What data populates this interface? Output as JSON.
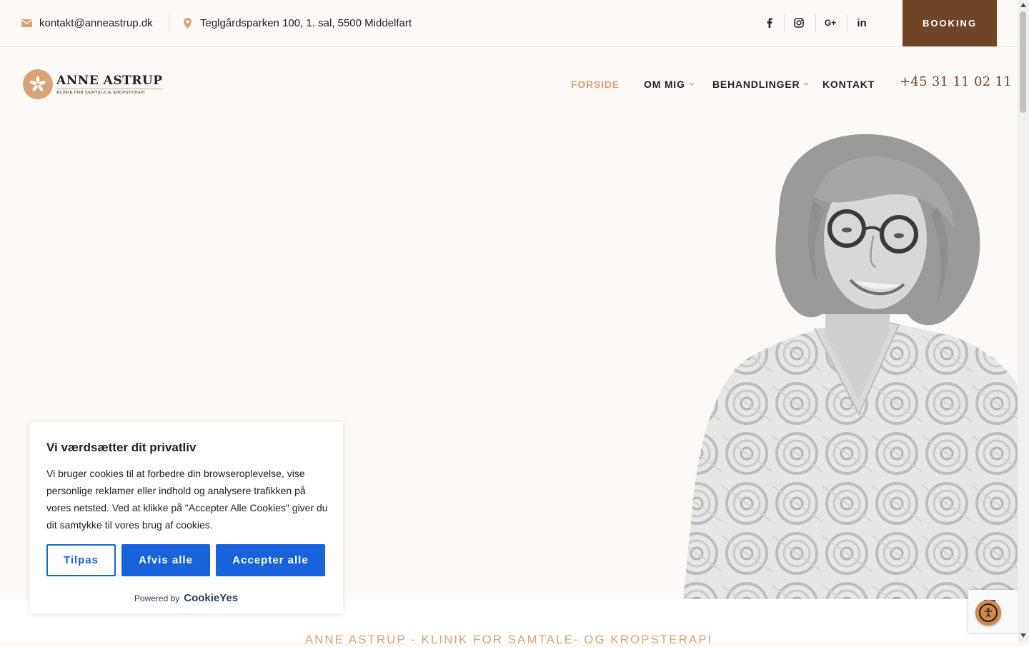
{
  "topbar": {
    "email": "kontakt@anneastrup.dk",
    "address": "Teglgårdsparken 100, 1. sal, 5500 Middelfart",
    "social": {
      "facebook": "f",
      "instagram": "instagram-icon",
      "googleplus": "G+",
      "linkedin": "in"
    },
    "booking_label": "BOOKING"
  },
  "logo": {
    "name": "ANNE ASTRUP",
    "subtitle": "KLINIK FOR SAMTALE & KROPSTERAPI"
  },
  "nav": {
    "items": [
      {
        "label": "FORSIDE",
        "active": true
      },
      {
        "label": "OM MIG",
        "dropdown": true
      },
      {
        "label": "BEHANDLINGER",
        "dropdown": true
      },
      {
        "label": "KONTAKT"
      }
    ],
    "phone": "+45 31 11 02 11"
  },
  "hero": {
    "tagline": "ANNE ASTRUP - KLINIK FOR SAMTALE- OG KROPSTERAPI"
  },
  "cookie": {
    "title": "Vi værdsætter dit privatliv",
    "description": "Vi bruger cookies til at forbedre din browseroplevelse, vise personlige reklamer eller indhold og analysere trafikken på vores netsted. Ved at klikke på \"Accepter Alle Cookies\" giver du dit samtykke til vores brug af cookies.",
    "customize_label": "Tilpas",
    "reject_label": "Afvis alle",
    "accept_label": "Accepter alle",
    "powered_by": "Powered by",
    "brand": "CookieYes"
  },
  "colors": {
    "accent": "#d4a47c",
    "brand_brown": "#6f4527",
    "cookie_blue": "#1863dc",
    "background": "#fdf9f6"
  }
}
